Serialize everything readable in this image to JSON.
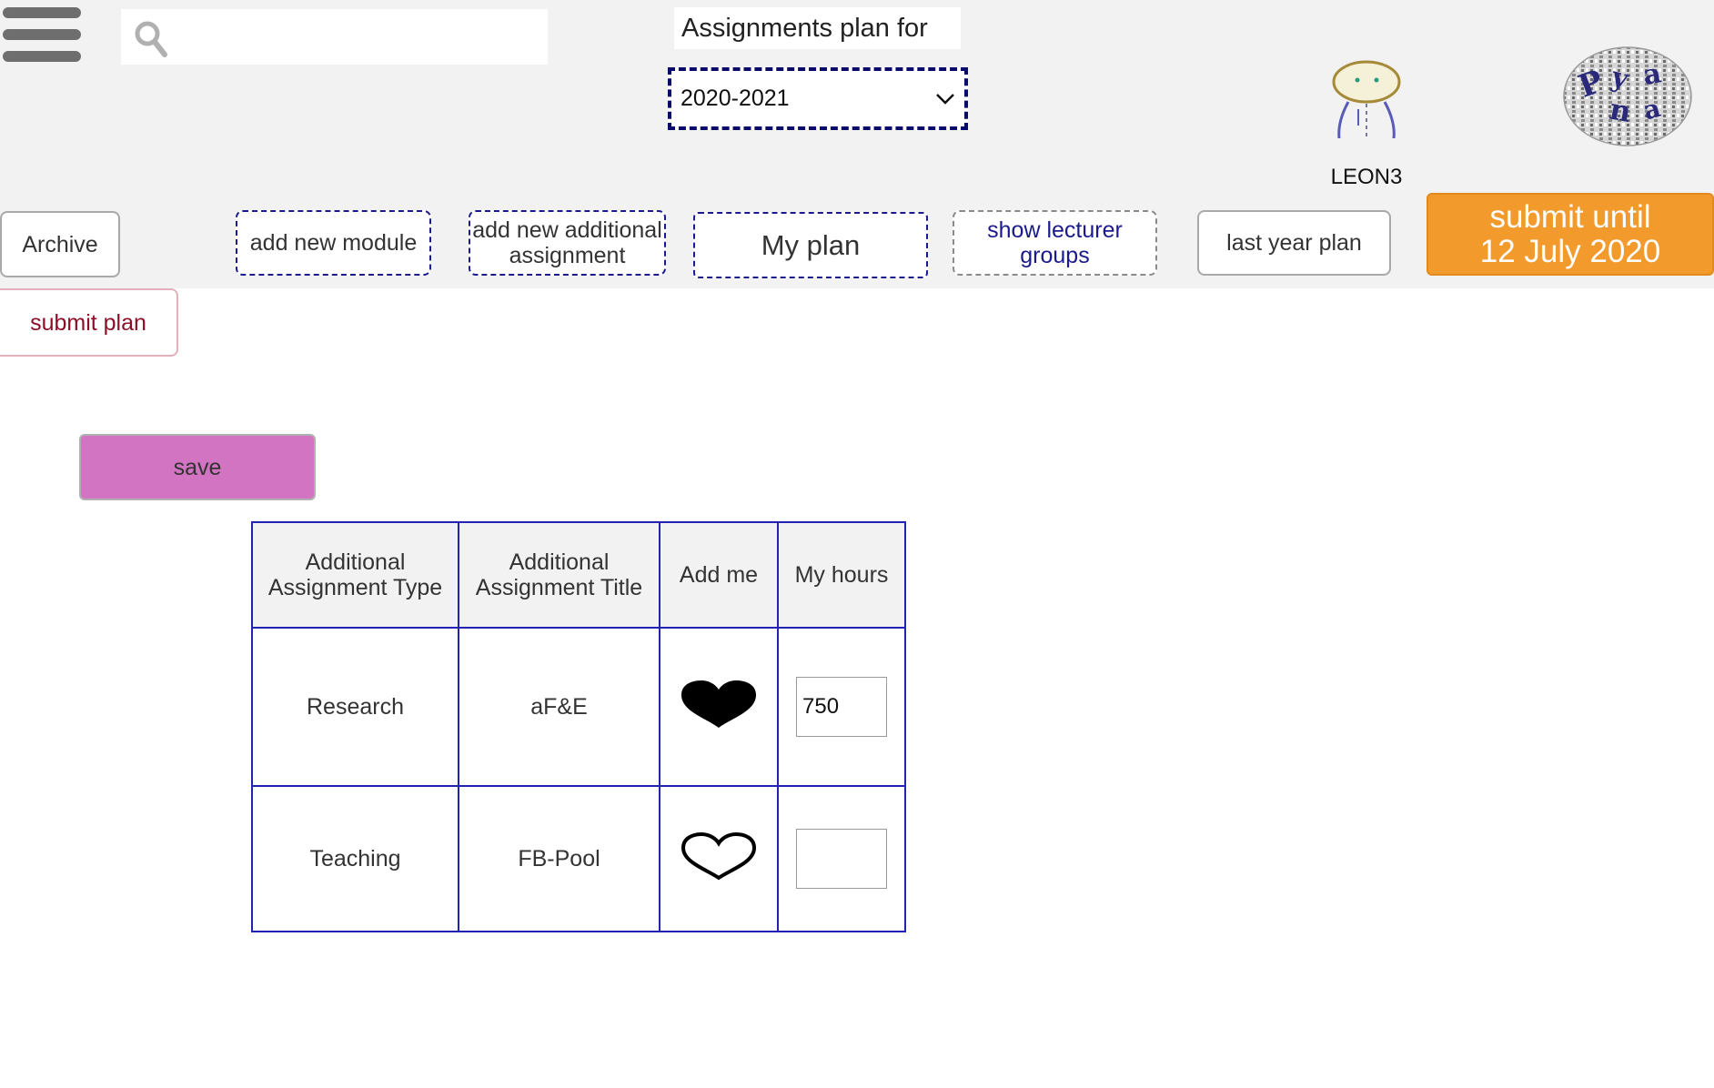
{
  "header": {
    "search": {
      "placeholder": "",
      "value": ""
    },
    "title": "Assignments plan for",
    "year_select": {
      "selected": "2020-2021"
    },
    "user": {
      "name": "LEON3"
    },
    "logo": {
      "letters": "Pyana"
    }
  },
  "toolbar": {
    "archive": "Archive",
    "add_module": "add new module",
    "add_additional_line1": "add new additional",
    "add_additional_line2": "assignment",
    "my_plan": "My plan",
    "show_groups_line1": "show lecturer",
    "show_groups_line2": "groups",
    "last_year": "last year plan",
    "submit_until_line1": "submit until",
    "submit_until_line2": "12 July 2020"
  },
  "actions": {
    "submit_plan": "submit plan",
    "save": "save"
  },
  "table": {
    "headers": {
      "type_line1": "Additional",
      "type_line2": "Assignment Type",
      "title_line1": "Additional",
      "title_line2": "Assignment Title",
      "add_me": "Add me",
      "hours": "My hours"
    },
    "rows": [
      {
        "type": "Research",
        "title": "aF&E",
        "added": true,
        "hours": "750"
      },
      {
        "type": "Teaching",
        "title": "FB-Pool",
        "added": false,
        "hours": ""
      }
    ]
  },
  "colors": {
    "submit_until_bg": "#f39a2c",
    "save_bg": "#d374c3",
    "table_border": "#2222b3",
    "submit_plan_text": "#8b0f29",
    "header_bg": "#f2f2f2"
  },
  "icons": {
    "menu": "hamburger-menu-icon",
    "search": "search-icon",
    "dropdown": "chevron-down-icon",
    "avatar": "user-avatar-icon",
    "added": "heart-filled-icon",
    "not_added": "heart-outline-icon"
  }
}
